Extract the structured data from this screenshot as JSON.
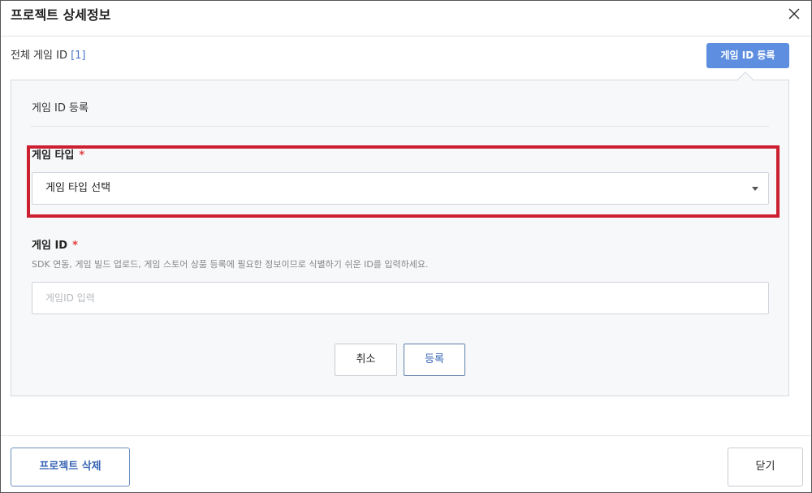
{
  "modal": {
    "title": "프로젝트 상세정보"
  },
  "summary": {
    "label": "전체 게임 ID",
    "count": "[1]"
  },
  "header_actions": {
    "register_button": "게임 ID 등록"
  },
  "form": {
    "title": "게임 ID 등록",
    "game_type": {
      "label": "게임 타입",
      "required_mark": "*",
      "selected_value": "게임 타입 선택"
    },
    "game_id": {
      "label": "게임 ID",
      "required_mark": "*",
      "help": "SDK 연동, 게임 빌드 업로드, 게임 스토어 상품 등록에 필요한 정보이므로 식별하기 쉬운 ID를 입력하세요.",
      "placeholder": "게임ID 입력",
      "value": ""
    },
    "cancel_label": "취소",
    "submit_label": "등록"
  },
  "footer": {
    "delete_label": "프로젝트 삭제",
    "close_label": "닫기"
  },
  "colors": {
    "primary": "#5d8ee0",
    "highlight": "#cc1f2f",
    "required": "#e03c3c"
  },
  "icons": {
    "close": "close-icon",
    "dropdown": "chevron-down-icon"
  }
}
